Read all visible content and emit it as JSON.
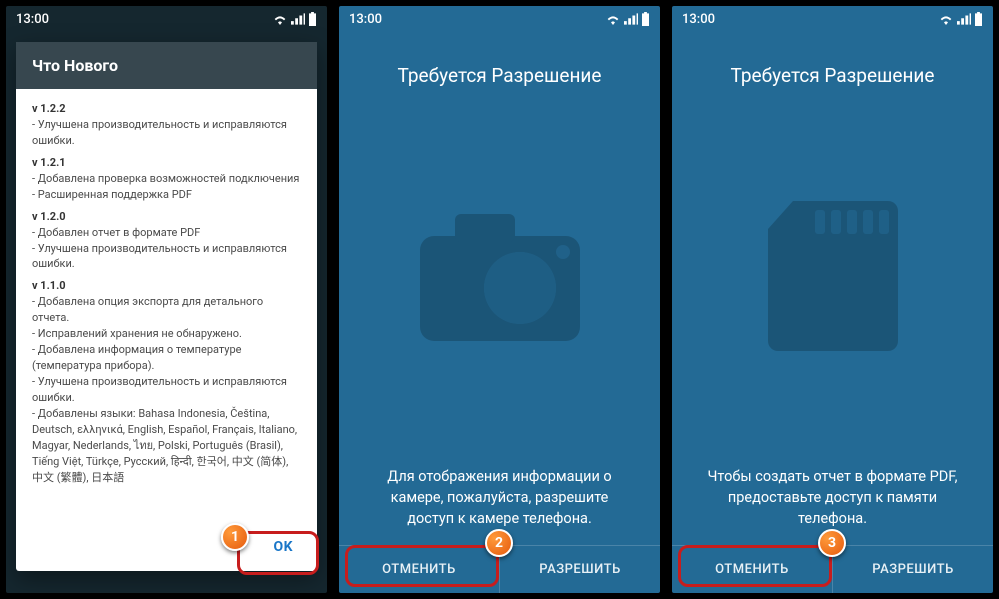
{
  "status": {
    "time": "13:00"
  },
  "screen1": {
    "dialog_title": "Что Нового",
    "versions": [
      {
        "head": "v 1.2.2",
        "items": [
          "- Улучшена производительность и исправляются ошибки."
        ]
      },
      {
        "head": "v 1.2.1",
        "items": [
          "- Добавлена проверка возможностей подключения",
          "- Расширенная поддержка PDF"
        ]
      },
      {
        "head": "v 1.2.0",
        "items": [
          "- Добавлен отчет в формате PDF",
          "- Улучшена производительность и исправляются ошибки."
        ]
      },
      {
        "head": "v 1.1.0",
        "items": [
          "- Добавлена опция экспорта для детального отчета.",
          "- Исправлений хранения не обнаружено.",
          "- Добавлена информация о температуре (температура прибора).",
          "- Улучшена производительность и исправляются ошибки.",
          "- Добавлены языки: Bahasa Indonesia, Čeština, Deutsch, ελληνικά, English, Español, Français, Italiano, Magyar, Nederlands, ไทย, Polski, Português (Brasil), Tiếng Việt, Türkçe, Русский, हिन्दी, 한국어, 中文 (简体), 中文 (繁體), 日本語"
        ]
      }
    ],
    "ok": "OK",
    "marker": "1"
  },
  "screen2": {
    "title": "Требуется Разрешение",
    "body": "Для отображения информации о камере, пожалуйста, разрешите доступ к камере телефона.",
    "cancel": "ОТМЕНИТЬ",
    "allow": "РАЗРЕШИТЬ",
    "marker": "2"
  },
  "screen3": {
    "title": "Требуется Разрешение",
    "body": "Чтобы создать отчет в формате PDF, предоставьте доступ к памяти телефона.",
    "cancel": "ОТМЕНИТЬ",
    "allow": "РАЗРЕШИТЬ",
    "marker": "3"
  }
}
